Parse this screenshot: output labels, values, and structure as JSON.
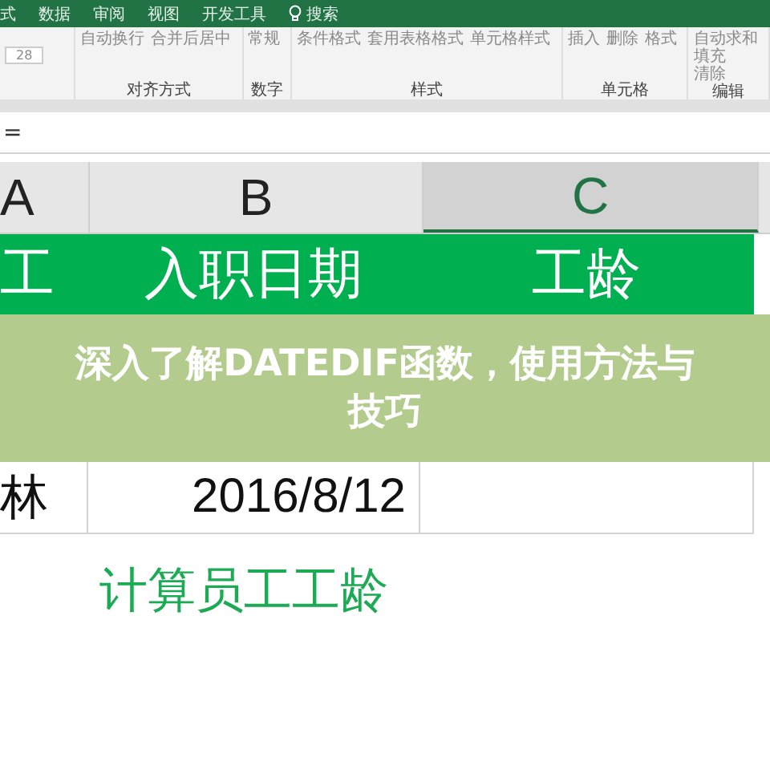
{
  "ribbon_tabs": [
    {
      "label": "式",
      "selected": false
    },
    {
      "label": "数据",
      "selected": false
    },
    {
      "label": "审阅",
      "selected": false
    },
    {
      "label": "视图",
      "selected": false
    },
    {
      "label": "开发工具",
      "selected": false
    }
  ],
  "search": {
    "label": "搜索"
  },
  "ribbon": {
    "font_size": "28",
    "groups": [
      {
        "label": "对齐方式",
        "kind": "buttons",
        "items": [
          "自动换行",
          "合并后居中"
        ]
      },
      {
        "label": "数字",
        "kind": "buttons",
        "items": [
          "常规"
        ]
      },
      {
        "label": "样式",
        "kind": "buttons",
        "items": [
          "条件格式",
          "套用表格格式",
          "单元格样式"
        ]
      },
      {
        "label": "单元格",
        "kind": "buttons",
        "items": [
          "插入",
          "删除",
          "格式"
        ]
      },
      {
        "label": "编辑",
        "kind": "stack",
        "items": [
          "自动求和",
          "填充",
          "清除"
        ]
      }
    ]
  },
  "formula_bar": {
    "content": "="
  },
  "columns": [
    {
      "label": "A",
      "selected": false
    },
    {
      "label": "B",
      "selected": false
    },
    {
      "label": "C",
      "selected": true
    }
  ],
  "rows": [
    {
      "kind": "header",
      "cells": [
        "工",
        "入职日期",
        "工龄"
      ]
    },
    {
      "kind": "data",
      "cells": [
        "林",
        "2016/8/12"
      ]
    }
  ],
  "caption": "计算员工工龄",
  "banner": "深入了解DATEDIF函数，使用方法与技巧"
}
